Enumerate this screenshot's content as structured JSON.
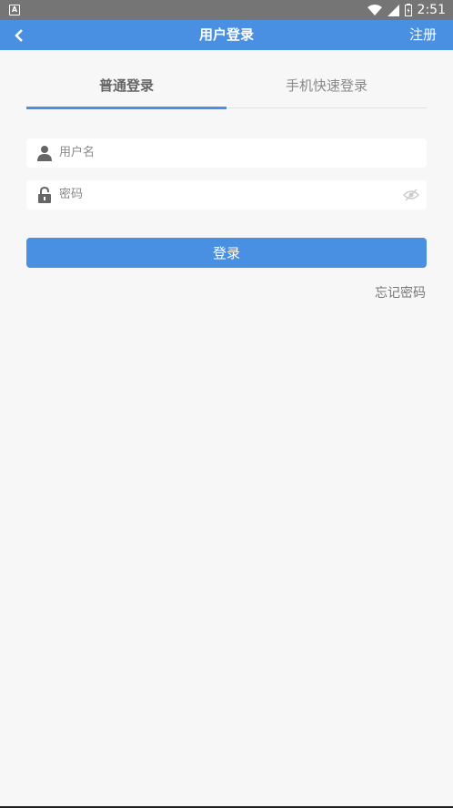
{
  "status_bar": {
    "left_icon": "A",
    "time": "2:51",
    "icons": [
      "wifi-icon",
      "signal-icon",
      "battery-icon"
    ]
  },
  "app_bar": {
    "title": "用户登录",
    "register_label": "注册",
    "back_icon": "chevron-left-icon"
  },
  "tabs": [
    {
      "label": "普通登录",
      "active": true
    },
    {
      "label": "手机快速登录",
      "active": false
    }
  ],
  "form": {
    "username": {
      "placeholder": "用户名",
      "value": "",
      "icon": "user-icon"
    },
    "password": {
      "placeholder": "密码",
      "value": "",
      "icon": "lock-icon",
      "toggle_icon": "eye-off-icon"
    },
    "submit_label": "登录",
    "forgot_label": "忘记密码"
  },
  "colors": {
    "accent": "#4a90e2",
    "status_bar": "#757575",
    "background": "#f7f7f7"
  }
}
